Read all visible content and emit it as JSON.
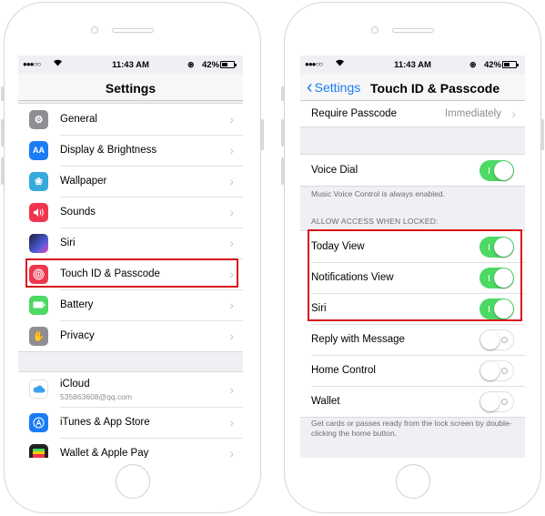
{
  "status_bar": {
    "signal": "●●●○○",
    "time": "11:43 AM",
    "battery": "42%"
  },
  "left_screen": {
    "title": "Settings",
    "items": [
      {
        "label": "General",
        "icon": "gear-icon",
        "color": "#8e8e93"
      },
      {
        "label": "Display & Brightness",
        "icon": "display-brightness-icon",
        "color": "#1a7cf5"
      },
      {
        "label": "Wallpaper",
        "icon": "wallpaper-icon",
        "color": "#35aadc"
      },
      {
        "label": "Sounds",
        "icon": "speaker-icon",
        "color": "#f0364f"
      },
      {
        "label": "Siri",
        "icon": "siri-icon",
        "color": "#1c1c3a"
      },
      {
        "label": "Touch ID & Passcode",
        "icon": "fingerprint-icon",
        "color": "#f0364f"
      },
      {
        "label": "Battery",
        "icon": "battery-icon",
        "color": "#4cd964"
      },
      {
        "label": "Privacy",
        "icon": "hand-icon",
        "color": "#8e8e93"
      }
    ],
    "account_items": [
      {
        "label": "iCloud",
        "sublabel": "535863608@qq.com",
        "icon": "cloud-icon",
        "color": "#ffffff"
      },
      {
        "label": "iTunes & App Store",
        "icon": "app-store-icon",
        "color": "#1a7cf5"
      },
      {
        "label": "Wallet & Apple Pay",
        "icon": "wallet-icon",
        "color": "#222222"
      }
    ]
  },
  "right_screen": {
    "back_label": "Settings",
    "title": "Touch ID & Passcode",
    "require_passcode": {
      "label": "Require Passcode",
      "value": "Immediately"
    },
    "voice_dial": {
      "label": "Voice Dial",
      "on": true
    },
    "voice_note": "Music Voice Control is always enabled.",
    "section_header": "ALLOW ACCESS WHEN LOCKED:",
    "toggles": [
      {
        "label": "Today View",
        "on": true
      },
      {
        "label": "Notifications View",
        "on": true
      },
      {
        "label": "Siri",
        "on": true
      },
      {
        "label": "Reply with Message",
        "on": false
      },
      {
        "label": "Home Control",
        "on": false
      },
      {
        "label": "Wallet",
        "on": false
      }
    ],
    "wallet_note": "Get cards or passes ready from the lock screen by double-clicking the home button."
  },
  "colors": {
    "accent": "#1a7cf5",
    "toggle_on": "#4cd964",
    "highlight": "#d9141b"
  }
}
